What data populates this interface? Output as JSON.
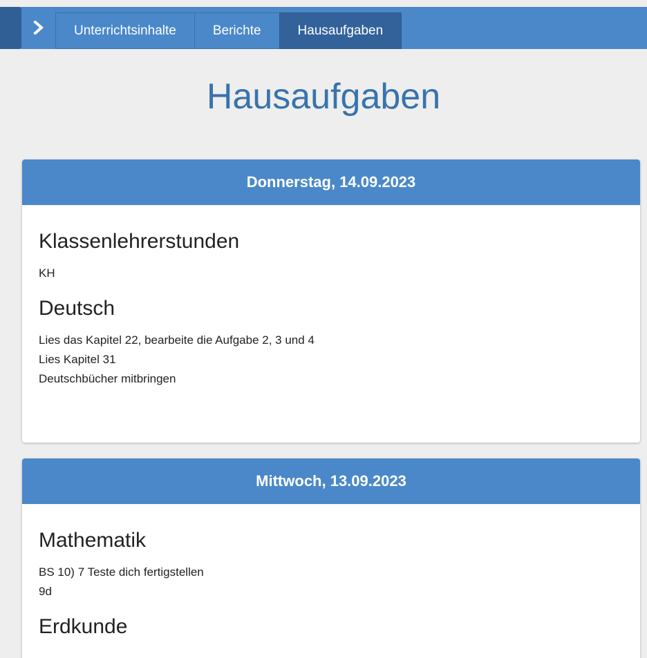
{
  "nav": {
    "tabs": [
      {
        "label": "Unterrichtsinhalte",
        "active": false
      },
      {
        "label": "Berichte",
        "active": false
      },
      {
        "label": "Hausaufgaben",
        "active": true
      }
    ]
  },
  "page": {
    "title": "Hausaufgaben"
  },
  "days": [
    {
      "date_label": "Donnerstag, 14.09.2023",
      "subjects": [
        {
          "name": "Klassenlehrerstunden",
          "tasks": [
            "KH"
          ]
        },
        {
          "name": "Deutsch",
          "tasks": [
            "Lies das Kapitel 22, bearbeite die Aufgabe 2, 3 und 4",
            "Lies Kapitel 31",
            "Deutschbücher mitbringen"
          ]
        }
      ]
    },
    {
      "date_label": "Mittwoch, 13.09.2023",
      "subjects": [
        {
          "name": "Mathematik",
          "tasks": [
            "BS 10) 7 Teste dich fertigstellen",
            "9d"
          ]
        },
        {
          "name": "Erdkunde",
          "tasks": []
        }
      ]
    }
  ],
  "colors": {
    "header_blue": "#4a88c9",
    "active_tab": "#33629b",
    "title_blue": "#3873ad",
    "background": "#eeeeee"
  }
}
